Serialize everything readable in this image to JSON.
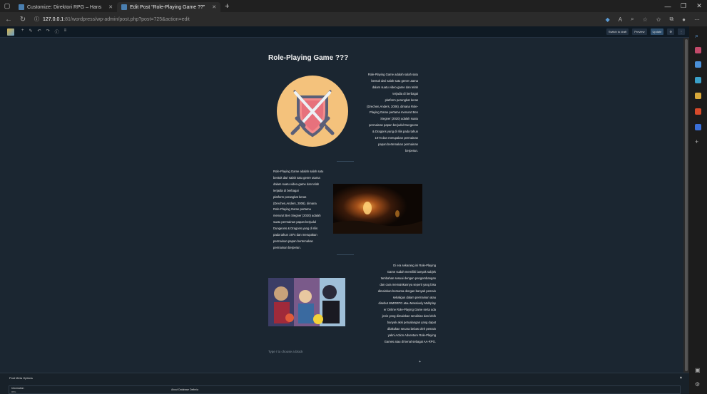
{
  "browser": {
    "tabs": [
      {
        "label": "Customize: Direktori RPG – Hans",
        "close": "✕"
      },
      {
        "label": "Edit Post “Role-Playing Game ??”",
        "close": "✕"
      }
    ],
    "new_tab": "+",
    "address": {
      "host": "127.0.0.1",
      "path": ":81/wordpress/wp-admin/post.php?post=725&action=edit"
    },
    "window_controls": [
      "—",
      "❐",
      "✕"
    ]
  },
  "toolbar": {
    "switch_draft": "Switch to draft",
    "preview": "Preview",
    "update": "Update"
  },
  "post": {
    "title": "Role-Playing Game ???",
    "para1": [
      "Role-Playing Game adalah salah satu",
      "bentuk dari salah satu genre utama",
      "dalam suatu video-game dan telah",
      "terjadia di berbagai",
      "platform perangkat keras",
      "(Drechen,Anders, 2006). dimana Role-",
      "Playing Game pertama menurut Ben",
      "Siegner (2020) adalah suatu",
      "permainan papan berjudul Dungeons",
      "& Dragons yang di rilis pada tahun",
      "1974 dan merupakan permainan",
      "papan bertemakan permainan",
      "berperan."
    ],
    "para2": [
      "Role-Playing Game adalah salah satu",
      "bentuk dari salah satu genre utama",
      "dalam suatu video-game dan telah",
      "terjadia di berbagai",
      "platform perangkat keras",
      "(Drechen,Anders, 2006). dimana",
      "Role-Playing Game pertama",
      "menurut Ben Siegner (2020) adalah",
      "suatu permainan papan berjudul",
      "Dungeons & Dragons yang di rilis",
      "pada tahun 1974 dan merupakan",
      "permainan papan bertemakan",
      "permainan berperan."
    ],
    "para3": [
      "Di era sekarang ini Role-Playing",
      "Game sudah memiliki banyak subjek",
      "tambahan sesuai dengan pengembangan",
      "dan cara memainkannya seperti yang bisa",
      "dimainkan bersama dengan banyak pemain",
      "sekaligus dalam permainan atau",
      "disebut MMORPG atau  Massively Multiplay",
      "er Online Role-Playing Game serta ada",
      "jenis yang dimainkan sendirian dan lebih",
      "banyak aksi petualangan yang dapat",
      "dilakukan secara bebas oleh pemain",
      "yakni Action Adventure Role-Playing",
      "Games atau di kenal sebagai AA-RPG."
    ],
    "placeholder": "Type / to choose a block"
  },
  "meta": {
    "title": "Post Meta Options",
    "tab": "Information",
    "tab_sub": "RPG",
    "heading": "About Database Defimia"
  },
  "colors": {
    "accent": "#4a7fb0",
    "editor_bg": "#1b2631",
    "shield_bg": "#f4c27c"
  }
}
